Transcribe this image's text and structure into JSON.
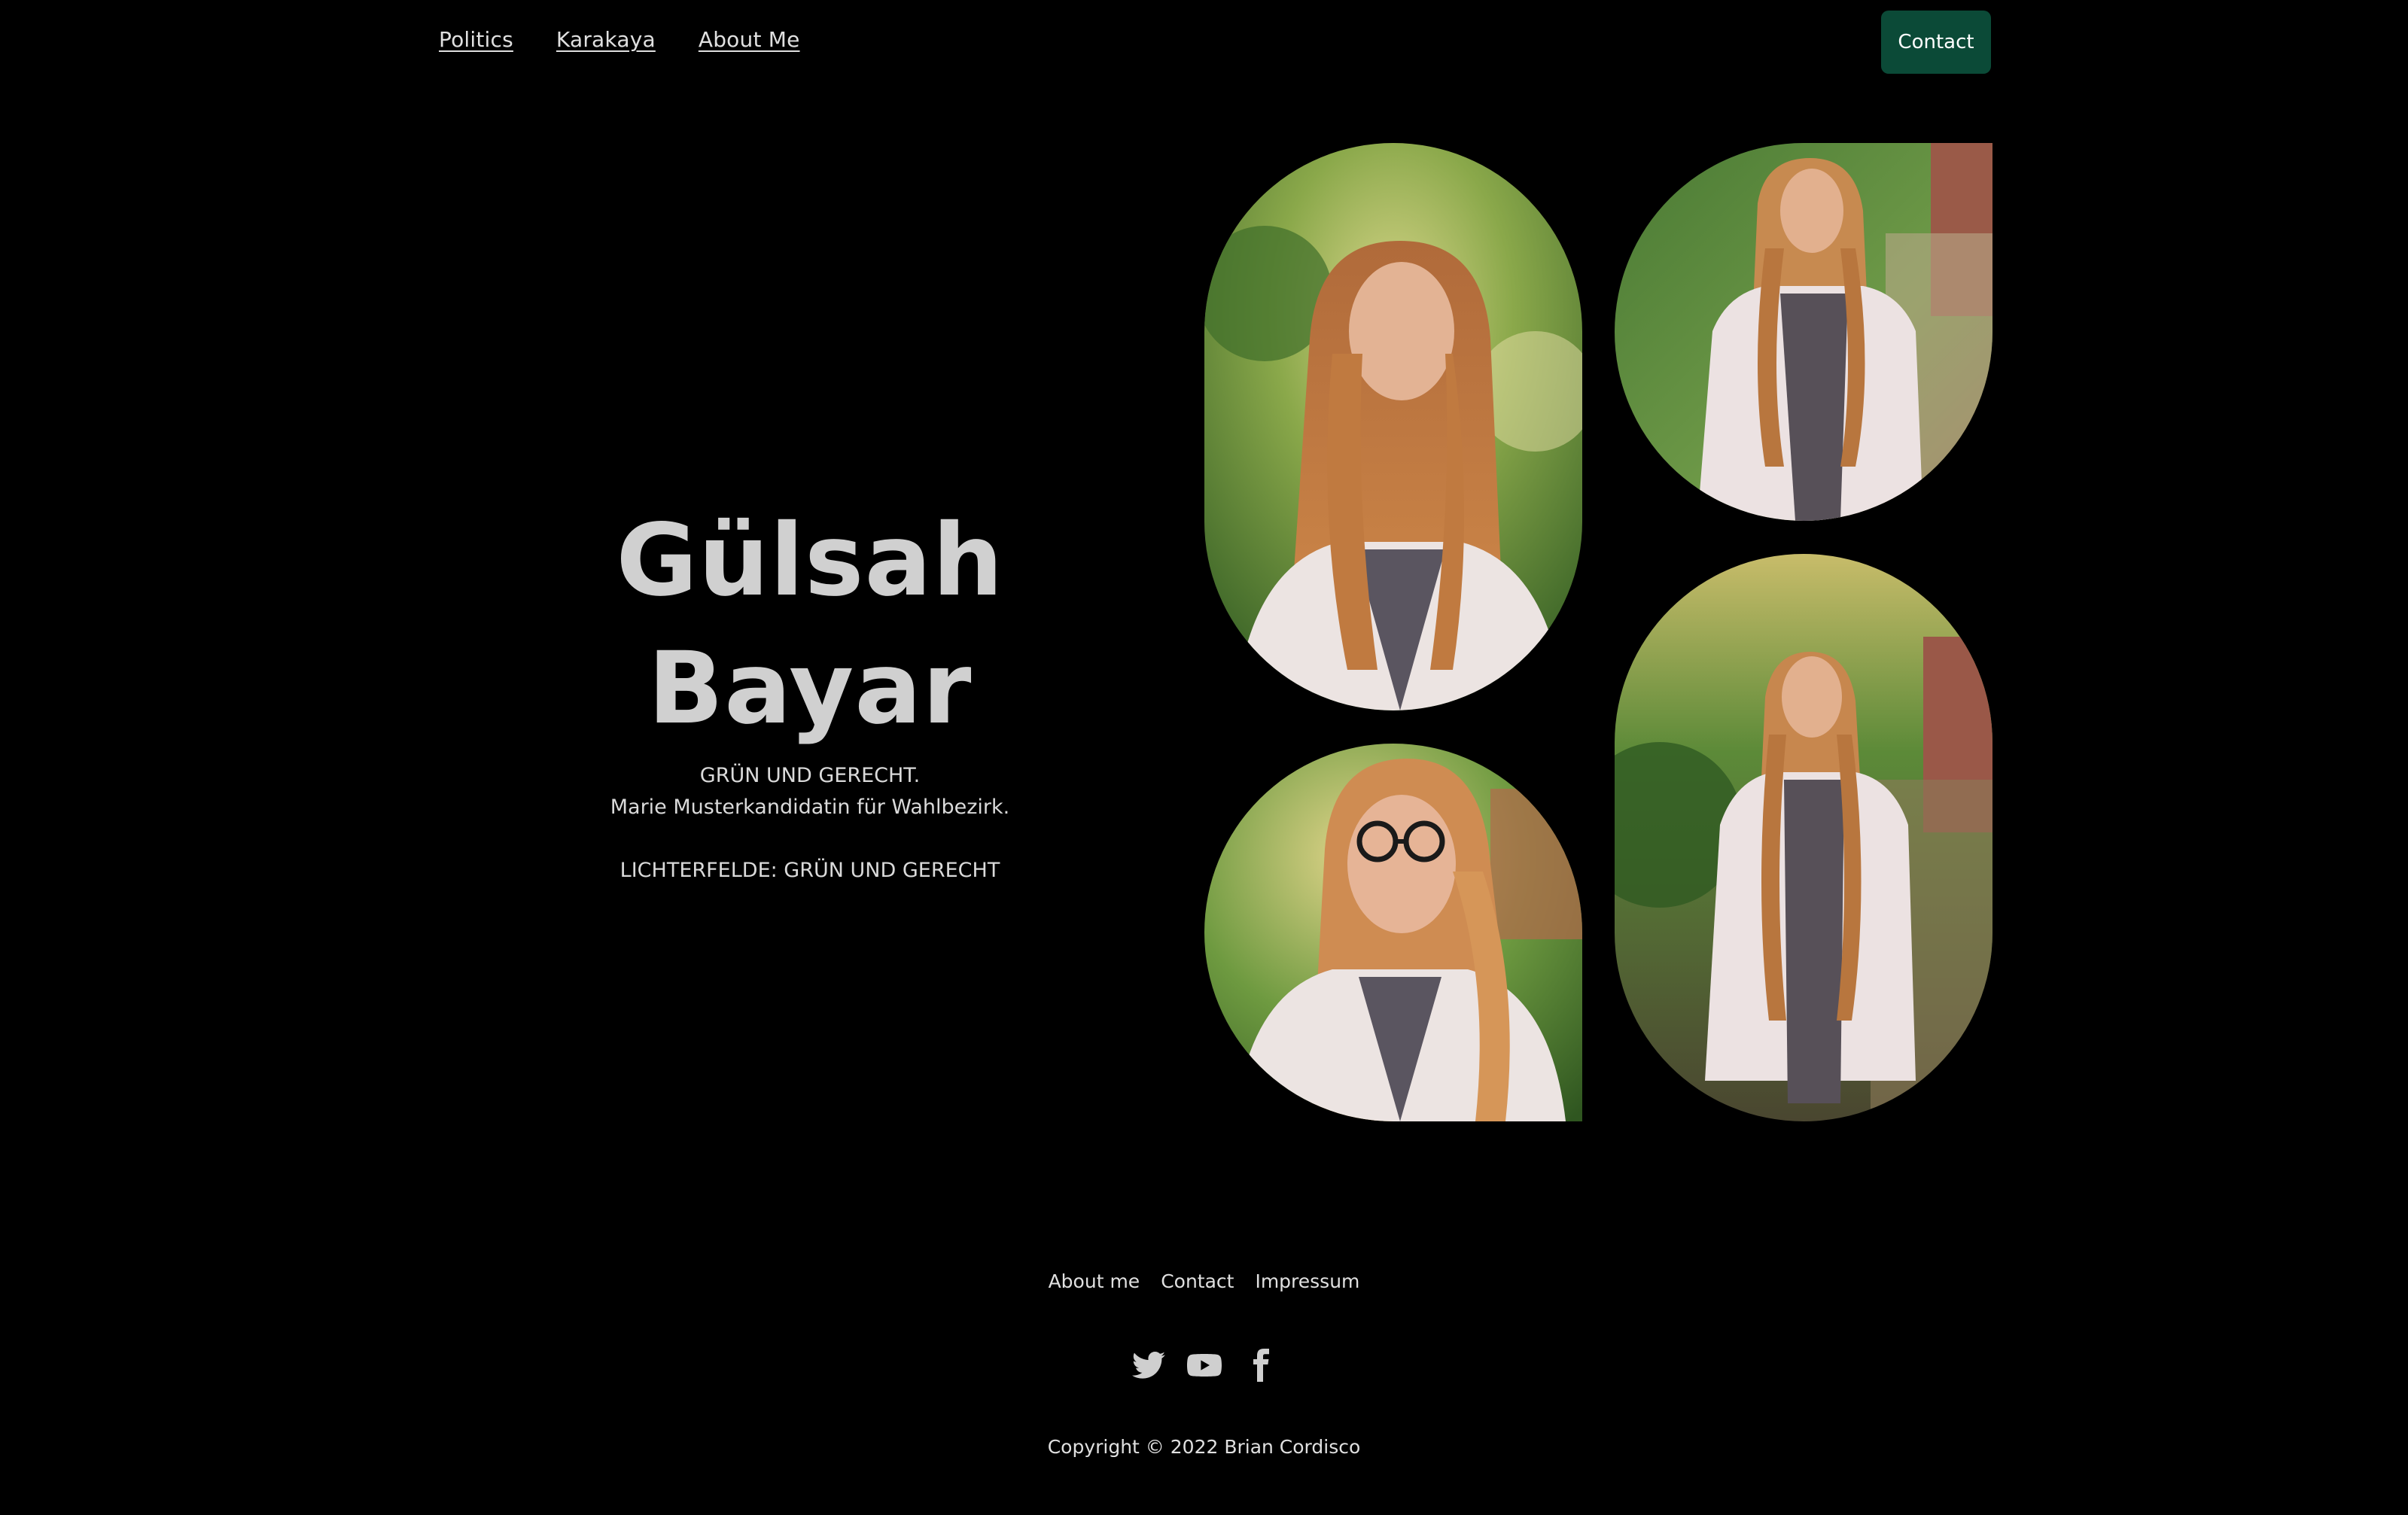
{
  "header": {
    "nav": [
      {
        "label": "Politics"
      },
      {
        "label": "Karakaya"
      },
      {
        "label": "About Me"
      }
    ],
    "contact_label": "Contact",
    "accent_color": "#0b4a37"
  },
  "hero": {
    "title": "Gülsah Bayar",
    "line1": "GRÜN UND GERECHT.",
    "line2": "Marie Musterkandidatin für Wahlbezirk.",
    "line3": "LICHTERFELDE: GRÜN UND GERECHT"
  },
  "gallery": {
    "photos": [
      {
        "icon": "portrait-photo"
      },
      {
        "icon": "full-body-photo"
      },
      {
        "icon": "portrait-glasses-photo"
      },
      {
        "icon": "full-body-photo"
      }
    ]
  },
  "footer": {
    "links": [
      {
        "label": "About me"
      },
      {
        "label": "Contact"
      },
      {
        "label": "Impressum"
      }
    ],
    "social": [
      "twitter-icon",
      "youtube-icon",
      "facebook-icon"
    ],
    "copyright": "Copyright © 2022 Brian Cordisco"
  }
}
